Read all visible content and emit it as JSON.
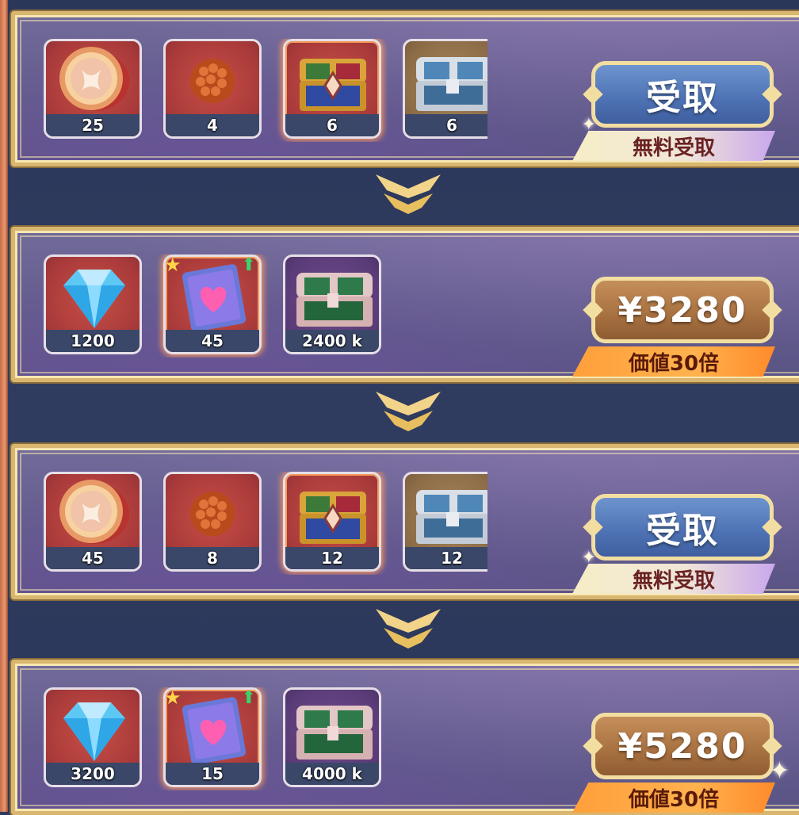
{
  "tiers": [
    {
      "items": [
        {
          "icon": "gold-coin-icon",
          "qty": "25",
          "bg": "red"
        },
        {
          "icon": "bead-cluster-icon",
          "qty": "4",
          "bg": "red"
        },
        {
          "icon": "golden-chest-icon",
          "qty": "6",
          "bg": "red"
        },
        {
          "icon": "silver-chest-icon",
          "qty": "6",
          "bg": "tan"
        }
      ],
      "button_label": "受取",
      "button_style": "blue",
      "tag_label": "無料受取",
      "tag_style": "free"
    },
    {
      "items": [
        {
          "icon": "diamond-icon",
          "qty": "1200",
          "bg": "red"
        },
        {
          "icon": "heart-book-icon",
          "qty": "45",
          "bg": "red"
        },
        {
          "icon": "green-chest-icon",
          "qty": "2400 k",
          "bg": "purple"
        }
      ],
      "button_label": "¥3280",
      "button_style": "brown",
      "tag_label": "価値30倍",
      "tag_style": "value"
    },
    {
      "items": [
        {
          "icon": "gold-coin-icon",
          "qty": "45",
          "bg": "red"
        },
        {
          "icon": "bead-cluster-icon",
          "qty": "8",
          "bg": "red"
        },
        {
          "icon": "golden-chest-icon",
          "qty": "12",
          "bg": "red"
        },
        {
          "icon": "silver-chest-icon",
          "qty": "12",
          "bg": "tan"
        }
      ],
      "button_label": "受取",
      "button_style": "blue",
      "tag_label": "無料受取",
      "tag_style": "free"
    },
    {
      "items": [
        {
          "icon": "diamond-icon",
          "qty": "3200",
          "bg": "red"
        },
        {
          "icon": "heart-book-icon",
          "qty": "15",
          "bg": "red"
        },
        {
          "icon": "green-chest-icon",
          "qty": "4000 k",
          "bg": "purple"
        }
      ],
      "button_label": "¥5280",
      "button_style": "brown",
      "tag_label": "価値30倍",
      "tag_style": "value"
    }
  ],
  "colors": {
    "background": "#2d3a5c",
    "frame_gold": "#d9b66f",
    "panel_purple": "#655e8f",
    "free_button_blue": "#4d71b3",
    "price_button_brown": "#a77040",
    "value_tag_orange": "#ff9f3a"
  }
}
